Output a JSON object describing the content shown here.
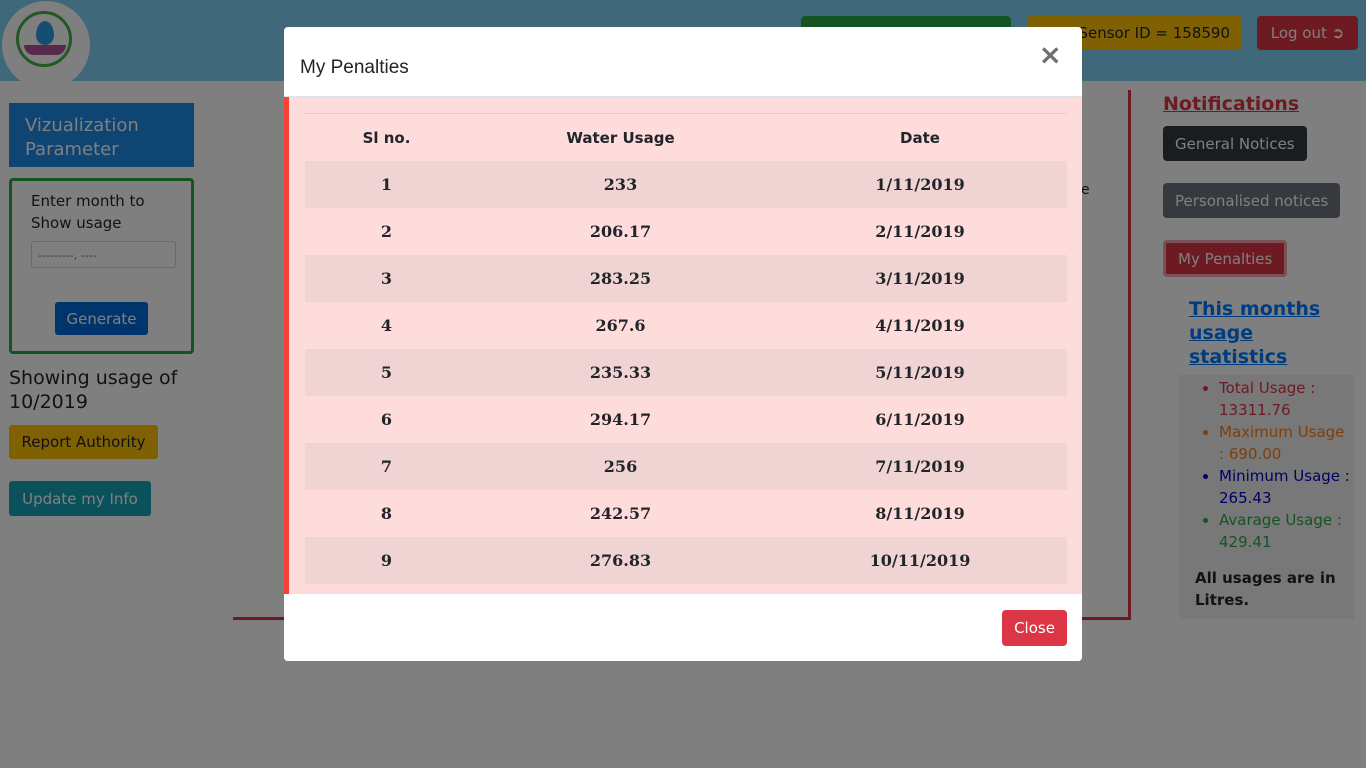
{
  "header": {
    "hidden_button_label": "",
    "sensor_label": "Sensor ID = 158590",
    "logout_label": "Log out",
    "logout_icon": "sign-out-icon"
  },
  "sidebar": {
    "title": "Vizualization Parameter",
    "month_prompt": "Enter month to Show usage",
    "month_placeholder": "---------, ----",
    "generate_label": "Generate",
    "showing_text": "Showing usage of 10/2019",
    "report_label": "Report Authority",
    "update_label": "Update my Info"
  },
  "main": {
    "peek_text": "e"
  },
  "notifications": {
    "title": "Notifications",
    "general_label": "General Notices",
    "personal_label": "Personalised notices",
    "penalties_label": "My Penalties"
  },
  "stats": {
    "title": "This months usage statistics",
    "items": [
      {
        "text": "Total Usage : 13311.76",
        "color": "#dc3545"
      },
      {
        "text": "Maximum Usage : 690.00",
        "color": "#fd7e14"
      },
      {
        "text": "Minimum Usage : 265.43",
        "color": "#0000cc"
      },
      {
        "text": "Avarage Usage : 429.41",
        "color": "#28a745"
      }
    ],
    "note": "All usages are in Litres."
  },
  "modal": {
    "title": "My Penalties",
    "close_x": "×",
    "columns": [
      "Sl no.",
      "Water Usage",
      "Date"
    ],
    "rows": [
      [
        "1",
        "233",
        "1/11/2019"
      ],
      [
        "2",
        "206.17",
        "2/11/2019"
      ],
      [
        "3",
        "283.25",
        "3/11/2019"
      ],
      [
        "4",
        "267.6",
        "4/11/2019"
      ],
      [
        "5",
        "235.33",
        "5/11/2019"
      ],
      [
        "6",
        "294.17",
        "6/11/2019"
      ],
      [
        "7",
        "256",
        "7/11/2019"
      ],
      [
        "8",
        "242.57",
        "8/11/2019"
      ],
      [
        "9",
        "276.83",
        "10/11/2019"
      ]
    ],
    "close_label": "Close",
    "colors": {
      "accent": "#f44336",
      "body_bg": "#ffdcdc",
      "close_btn": "#dc3545"
    }
  }
}
